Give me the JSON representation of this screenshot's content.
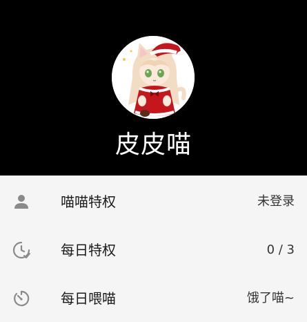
{
  "profile": {
    "username": "皮皮喵",
    "avatar_icon": "anime-cat-girl-avatar"
  },
  "menu": {
    "items": [
      {
        "icon": "person-icon",
        "label": "喵喵特权",
        "value": "未登录"
      },
      {
        "icon": "clock-check-icon",
        "label": "每日特权",
        "value": "0 / 3"
      },
      {
        "icon": "timer-icon",
        "label": "每日喂喵",
        "value": "饿了喵~"
      }
    ]
  },
  "colors": {
    "header_bg": "#000000",
    "list_bg": "#f5f5f5",
    "icon_gray": "#8a8a8a"
  }
}
